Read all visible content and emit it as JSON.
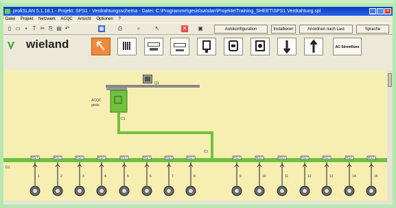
{
  "window": {
    "title": "profiSLAN 5.1.18.1 - Projekt: SPS1 - Verdrahtungsschema - Datei: C:\\Programme\\gesis\\sa\\slan\\Projekte\\Training_SHEET\\SPS1 Verdrahtung.spl"
  },
  "menu": {
    "items": [
      "Datei",
      "Projekt",
      "Netzwerk",
      "ACQC",
      "Ansicht",
      "Optionen",
      "?"
    ]
  },
  "toolbar": {
    "auto_label": "Autokonfiguration",
    "install_label": "Installieren",
    "arrange_label": "Anordnen nach Last",
    "language_label": "Sprache"
  },
  "palette": {
    "brand": "wieland",
    "ac_label": "AC Stromfluss",
    "items": [
      "select-tool",
      "distribution-box",
      "bus-adapter",
      "t-connector",
      "power-plug",
      "socket",
      "motor-module",
      "arrow-down",
      "arrow-up"
    ]
  },
  "diagram": {
    "source_label": "Q1",
    "feeder_caption_1": "ACQC",
    "feeder_caption_2": "gesis",
    "cable_label_1": "C1",
    "cable_label_2": "C1",
    "bus_label": "D1",
    "tap_caption": "RST",
    "left_taps": [
      "1",
      "2",
      "3",
      "4",
      "5",
      "6",
      "7",
      "8"
    ],
    "right_taps": [
      "9",
      "10",
      "11",
      "12",
      "13",
      "14",
      "15"
    ]
  },
  "colors": {
    "titlebar": "#0a3cc7",
    "canvas": "#f7efb2",
    "cable": "#6fc13e",
    "highlight": "#ef8a3c",
    "border": "#b7e7b0"
  }
}
